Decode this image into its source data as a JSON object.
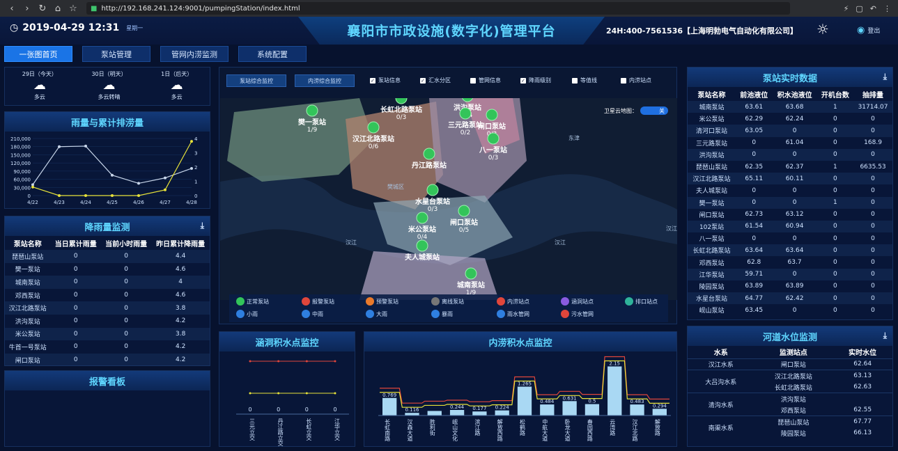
{
  "browser": {
    "url": "http://192.168.241.124:9001/pumpingStation/index.html"
  },
  "header": {
    "datetime": "2019-04-29 12:31",
    "weekday": "星期一",
    "title": "襄阳市市政设施(数字化)管理平台",
    "hotline": "24H:400-7561536【上海明勃电气自动化有限公司】",
    "login": "登出"
  },
  "nav": [
    "一张图首页",
    "泵站管理",
    "管网内涝监测",
    "系统配置"
  ],
  "weather": [
    {
      "day": "29日（今天）",
      "desc": "多云"
    },
    {
      "day": "30日（明天）",
      "desc": "多云转晴"
    },
    {
      "day": "1日（后天）",
      "desc": "多云"
    }
  ],
  "rain_chart": {
    "title": "雨量与累计排涝量",
    "chart_data": {
      "type": "line",
      "categories": [
        "4/22",
        "4/23",
        "4/24",
        "4/25",
        "4/26",
        "4/27",
        "4/28"
      ],
      "y_left_ticks": [
        "210,000",
        "180,000",
        "150,000",
        "120,000",
        "90,000",
        "60,000",
        "30,000",
        "0"
      ],
      "y_right_ticks": [
        "4",
        "3",
        "2",
        "1",
        "0"
      ],
      "series": [
        {
          "values": [
            40000,
            180000,
            182000,
            75000,
            45000,
            65000,
            100000
          ],
          "axis": "left",
          "color": "#c8d6ea"
        },
        {
          "values": [
            0.6,
            0,
            0,
            0,
            0,
            0.4,
            3.8
          ],
          "axis": "right",
          "color": "#e7e23a"
        }
      ],
      "ylim_left": [
        0,
        210000
      ],
      "ylim_right": [
        0,
        4
      ]
    }
  },
  "rain_monitor": {
    "title": "降雨量监测",
    "columns": [
      "泵站名称",
      "当日累计雨量",
      "当前小时雨量",
      "昨日累计降雨量"
    ],
    "rows": [
      [
        "琵琶山泵站",
        "0",
        "0",
        "4.4"
      ],
      [
        "樊一泵站",
        "0",
        "0",
        "4.6"
      ],
      [
        "城南泵站",
        "0",
        "0",
        "4"
      ],
      [
        "邓西泵站",
        "0",
        "0",
        "4.6"
      ],
      [
        "汉江北路泵站",
        "0",
        "0",
        "3.8"
      ],
      [
        "洪沟泵站",
        "0",
        "0",
        "4.2"
      ],
      [
        "米公泵站",
        "0",
        "0",
        "3.8"
      ],
      [
        "牛首一号泵站",
        "0",
        "0",
        "4.2"
      ],
      [
        "闸口泵站",
        "0",
        "0",
        "4.2"
      ]
    ]
  },
  "alarm_board": {
    "title": "报警看板"
  },
  "map": {
    "buttons": [
      "泵站综合监控",
      "内涝综合监控"
    ],
    "checks": [
      {
        "label": "泵站信息",
        "checked": true
      },
      {
        "label": "汇水分区",
        "checked": true
      },
      {
        "label": "管网信息",
        "checked": false
      },
      {
        "label": "降雨级别",
        "checked": true
      },
      {
        "label": "等值线",
        "checked": false
      },
      {
        "label": "内涝站点",
        "checked": false
      }
    ],
    "satellite_label": "卫星云地图：",
    "satellite_state": "关",
    "areas": [
      "樊城区",
      "汉江",
      "汉江",
      "汉江",
      "东津"
    ],
    "stations": [
      {
        "name": "樊一泵站",
        "count": "1/9"
      },
      {
        "name": "长虹北路泵站",
        "count": "0/3"
      },
      {
        "name": "洪沟泵站",
        "count": "0/4"
      },
      {
        "name": "三元路泵站",
        "count": "0/2"
      },
      {
        "name": "闸口泵站",
        "count": "0/3"
      },
      {
        "name": "汉江北路泵站",
        "count": "0/6"
      },
      {
        "name": "丹江路泵站",
        "count": ""
      },
      {
        "name": "八一泵站",
        "count": "0/3"
      },
      {
        "name": "水星台泵站",
        "count": "0/3"
      },
      {
        "name": "米公泵站",
        "count": "0/4"
      },
      {
        "name": "闸口泵站",
        "count": "0/5"
      },
      {
        "name": "夫人城泵站",
        "count": ""
      },
      {
        "name": "城南泵站",
        "count": "1/9"
      }
    ],
    "legend": [
      "正常泵站",
      "报警泵站",
      "预警泵站",
      "离线泵站",
      "内涝站点",
      "涵洞站点",
      "排口站点",
      "小雨",
      "中雨",
      "大雨",
      "暴雨",
      "雨水管网",
      "污水管网"
    ]
  },
  "culvert": {
    "title": "涵洞积水点监控",
    "chart_data": {
      "type": "line",
      "categories": [
        "三元立交",
        "丹江路立交",
        "长虹立交",
        "江华立交"
      ],
      "values": [
        0,
        0,
        0,
        0
      ]
    }
  },
  "waterlogging": {
    "title": "内涝积水点监控",
    "chart_data": {
      "type": "bar",
      "categories": [
        "长虹南路",
        "汉森大道",
        "胜利街",
        "岘山文化",
        "滨江路",
        "解放西路",
        "松鹤路",
        "中航大道",
        "卧龙大道",
        "春园西路",
        "云湾路",
        "汉江北路",
        "解放路"
      ],
      "values": [
        0.769,
        0.116,
        0.2,
        0.244,
        0.177,
        0.224,
        1.265,
        0.484,
        0.631,
        0.5,
        2.15,
        0.483,
        0.294
      ],
      "labels": [
        "0.769",
        "0.116",
        "",
        "0.244",
        "0.177",
        "0.224",
        "1.265",
        "0.484",
        "0.631",
        "0.5",
        "2.15",
        "0.483",
        "0.294"
      ]
    }
  },
  "pump_realtime": {
    "title": "泵站实时数据",
    "columns": [
      "泵站名称",
      "前池液位",
      "积水池液位",
      "开机台数",
      "抽排量"
    ],
    "rows": [
      [
        "城南泵站",
        "63.61",
        "63.68",
        "1",
        "31714.07"
      ],
      [
        "米公泵站",
        "62.29",
        "62.24",
        "0",
        "0"
      ],
      [
        "清河口泵站",
        "63.05",
        "0",
        "0",
        "0"
      ],
      [
        "三元路泵站",
        "0",
        "61.04",
        "0",
        "168.9"
      ],
      [
        "洪沟泵站",
        "0",
        "0",
        "0",
        "0"
      ],
      [
        "琵琶山泵站",
        "62.35",
        "62.37",
        "1",
        "6635.53"
      ],
      [
        "汉江北路泵站",
        "65.11",
        "60.11",
        "0",
        "0"
      ],
      [
        "夫人城泵站",
        "0",
        "0",
        "0",
        "0"
      ],
      [
        "樊一泵站",
        "0",
        "0",
        "1",
        "0"
      ],
      [
        "闸口泵站",
        "62.73",
        "63.12",
        "0",
        "0"
      ],
      [
        "102泵站",
        "61.54",
        "60.94",
        "0",
        "0"
      ],
      [
        "八一泵站",
        "0",
        "0",
        "0",
        "0"
      ],
      [
        "长虹北路泵站",
        "63.64",
        "63.64",
        "0",
        "0"
      ],
      [
        "邓西泵站",
        "62.8",
        "63.7",
        "0",
        "0"
      ],
      [
        "江华泵站",
        "59.71",
        "0",
        "0",
        "0"
      ],
      [
        "陵园泵站",
        "63.89",
        "63.89",
        "0",
        "0"
      ],
      [
        "水星台泵站",
        "64.77",
        "62.42",
        "0",
        "0"
      ],
      [
        "岘山泵站",
        "63.45",
        "0",
        "0",
        "0"
      ]
    ]
  },
  "river_level": {
    "title": "河道水位监测",
    "columns": [
      "水系",
      "监测站点",
      "实时水位"
    ],
    "groups": [
      {
        "system": "汉江水系",
        "rows": [
          [
            "闸口泵站",
            "62.64"
          ]
        ]
      },
      {
        "system": "大吕沟水系",
        "rows": [
          [
            "汉江北路泵站",
            "63.13"
          ],
          [
            "长虹北路泵站",
            "62.63"
          ]
        ]
      },
      {
        "system": "清沟水系",
        "rows": [
          [
            "洪沟泵站",
            ""
          ],
          [
            "邓西泵站",
            "62.55"
          ]
        ]
      },
      {
        "system": "南渠水系",
        "rows": [
          [
            "琵琶山泵站",
            "67.77"
          ],
          [
            "陵园泵站",
            "66.13"
          ]
        ]
      }
    ]
  }
}
